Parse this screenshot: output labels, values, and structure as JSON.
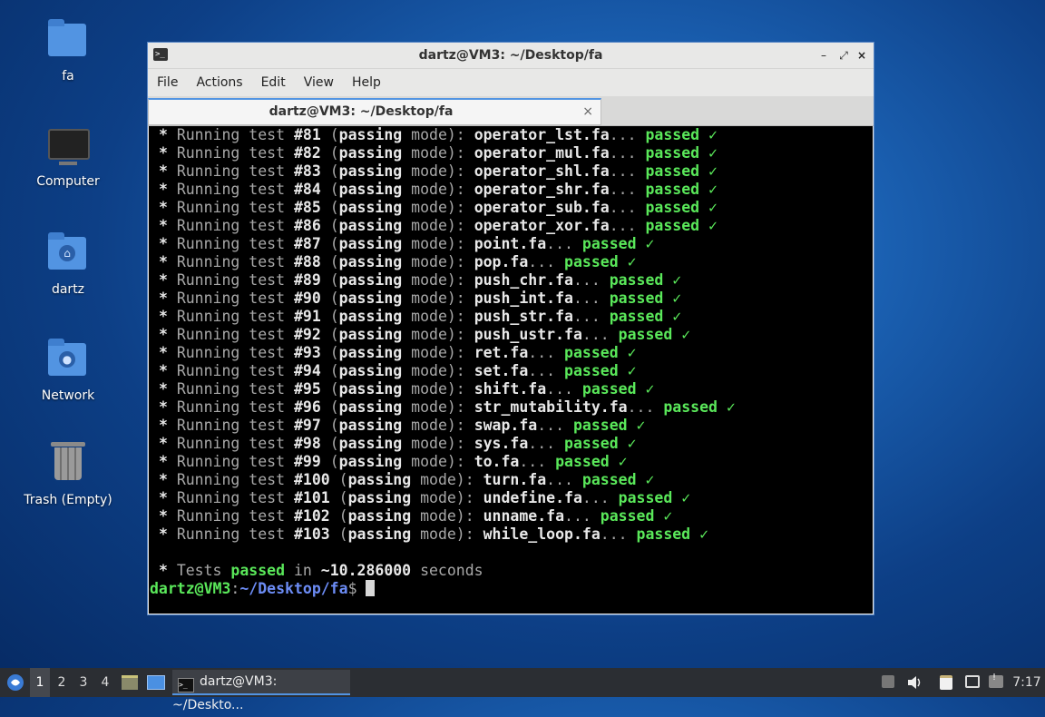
{
  "desktop": {
    "icons": [
      {
        "label": "fa",
        "icon": "folder-icon"
      },
      {
        "label": "Computer",
        "icon": "computer-icon"
      },
      {
        "label": "dartz",
        "icon": "home-folder-icon"
      },
      {
        "label": "Network",
        "icon": "network-folder-icon"
      },
      {
        "label": "Trash (Empty)",
        "icon": "trash-icon"
      }
    ]
  },
  "window": {
    "title": "dartz@VM3: ~/Desktop/fa",
    "menu": [
      "File",
      "Actions",
      "Edit",
      "View",
      "Help"
    ],
    "tab_label": "dartz@VM3: ~/Desktop/fa",
    "tab_close": "×",
    "buttons": {
      "minimize": "–",
      "maximize": "⤢",
      "close": "×"
    }
  },
  "terminal": {
    "tests": [
      {
        "num": "#81",
        "file": "operator_lst.fa"
      },
      {
        "num": "#82",
        "file": "operator_mul.fa"
      },
      {
        "num": "#83",
        "file": "operator_shl.fa"
      },
      {
        "num": "#84",
        "file": "operator_shr.fa"
      },
      {
        "num": "#85",
        "file": "operator_sub.fa"
      },
      {
        "num": "#86",
        "file": "operator_xor.fa"
      },
      {
        "num": "#87",
        "file": "point.fa"
      },
      {
        "num": "#88",
        "file": "pop.fa"
      },
      {
        "num": "#89",
        "file": "push_chr.fa"
      },
      {
        "num": "#90",
        "file": "push_int.fa"
      },
      {
        "num": "#91",
        "file": "push_str.fa"
      },
      {
        "num": "#92",
        "file": "push_ustr.fa"
      },
      {
        "num": "#93",
        "file": "ret.fa"
      },
      {
        "num": "#94",
        "file": "set.fa"
      },
      {
        "num": "#95",
        "file": "shift.fa"
      },
      {
        "num": "#96",
        "file": "str_mutability.fa"
      },
      {
        "num": "#97",
        "file": "swap.fa"
      },
      {
        "num": "#98",
        "file": "sys.fa"
      },
      {
        "num": "#99",
        "file": "to.fa"
      },
      {
        "num": "#100",
        "file": "turn.fa"
      },
      {
        "num": "#101",
        "file": "undefine.fa"
      },
      {
        "num": "#102",
        "file": "unname.fa"
      },
      {
        "num": "#103",
        "file": "while_loop.fa"
      }
    ],
    "line_prefix": "Running test",
    "mode_word": "passing",
    "mode_suffix": "mode",
    "status": "passed",
    "check": "✓",
    "summary": {
      "prefix": "Tests",
      "status": "passed",
      "middle": "in",
      "time": "~10.286000",
      "unit": "seconds"
    },
    "prompt": {
      "user": "dartz@VM3",
      "path": "~/Desktop/fa",
      "symbol": "$"
    }
  },
  "taskbar": {
    "workspaces": [
      "1",
      "2",
      "3",
      "4"
    ],
    "active_workspace": "1",
    "task_label": "dartz@VM3: ~/Deskto...",
    "clock": "7:17"
  },
  "colors": {
    "passed": "#5ae85a",
    "path": "#6c8cf5",
    "accent": "#5294e2",
    "terminal_bg": "#000000"
  }
}
